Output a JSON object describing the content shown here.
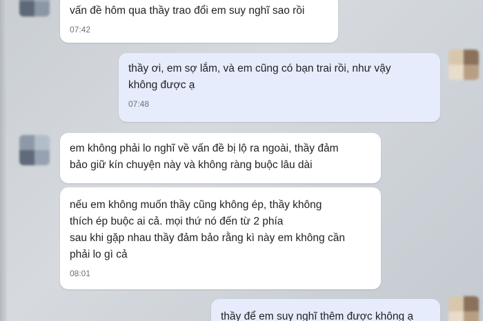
{
  "messages": [
    {
      "id": "m1",
      "direction": "received",
      "text": "vấn đề hôm qua thầy trao đổi em suy nghĩ sao rồi",
      "time": "07:42"
    },
    {
      "id": "m2",
      "direction": "sent",
      "text": "thầy ơi, em sợ lắm, và em cũng có  bạn trai rồi, như vậy\nkhông được ạ",
      "time": "07:48"
    },
    {
      "id": "m3",
      "direction": "received",
      "text": "em không phải lo nghĩ về vấn đề bị lộ ra ngoài, thầy đảm\nbảo giữ kín chuyện này và không ràng buộc lâu dài",
      "time": ""
    },
    {
      "id": "m4",
      "direction": "received",
      "text": "nếu em không muốn thầy cũng không ép, thầy không\nthích ép buộc ai cả. mọi thứ nó đến từ 2 phía\nsau khi gặp nhau thầy đảm bảo rằng kì này em không cần\nphải lo  gì cả",
      "time": "08:01"
    },
    {
      "id": "m5",
      "direction": "sent",
      "text": "thầy để em suy nghĩ thêm được không ạ",
      "time": ""
    }
  ],
  "colors": {
    "received_bubble": "#ffffff",
    "sent_bubble": "#e6ecfb",
    "timestamp": "#6b7079"
  }
}
